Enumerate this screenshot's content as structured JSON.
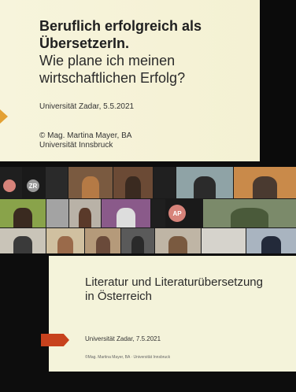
{
  "slide1": {
    "title": "Beruflich erfolgreich als ÜbersetzerIn.",
    "subtitle": "Wie plane ich meinen wirtschaftlichen Erfolg?",
    "university_date": "Universität Zadar, 5.5.2021",
    "author_line1": "© Mag. Martina Mayer, BA",
    "author_line2": "Universität Innsbruck"
  },
  "participants": {
    "avatar_zr": "ZR",
    "avatar_ap": "AP"
  },
  "slide2": {
    "title": "Literatur und Literaturübersetzung in Österreich",
    "university_date": "Universität Zadar, 7.5.2021",
    "author": "©Mag. Martina Mayer, BA · Universität Innsbruck"
  },
  "colors": {
    "accent_orange": "#e3a033",
    "accent_red": "#c7421d",
    "avatar_pink": "#d7837a"
  }
}
